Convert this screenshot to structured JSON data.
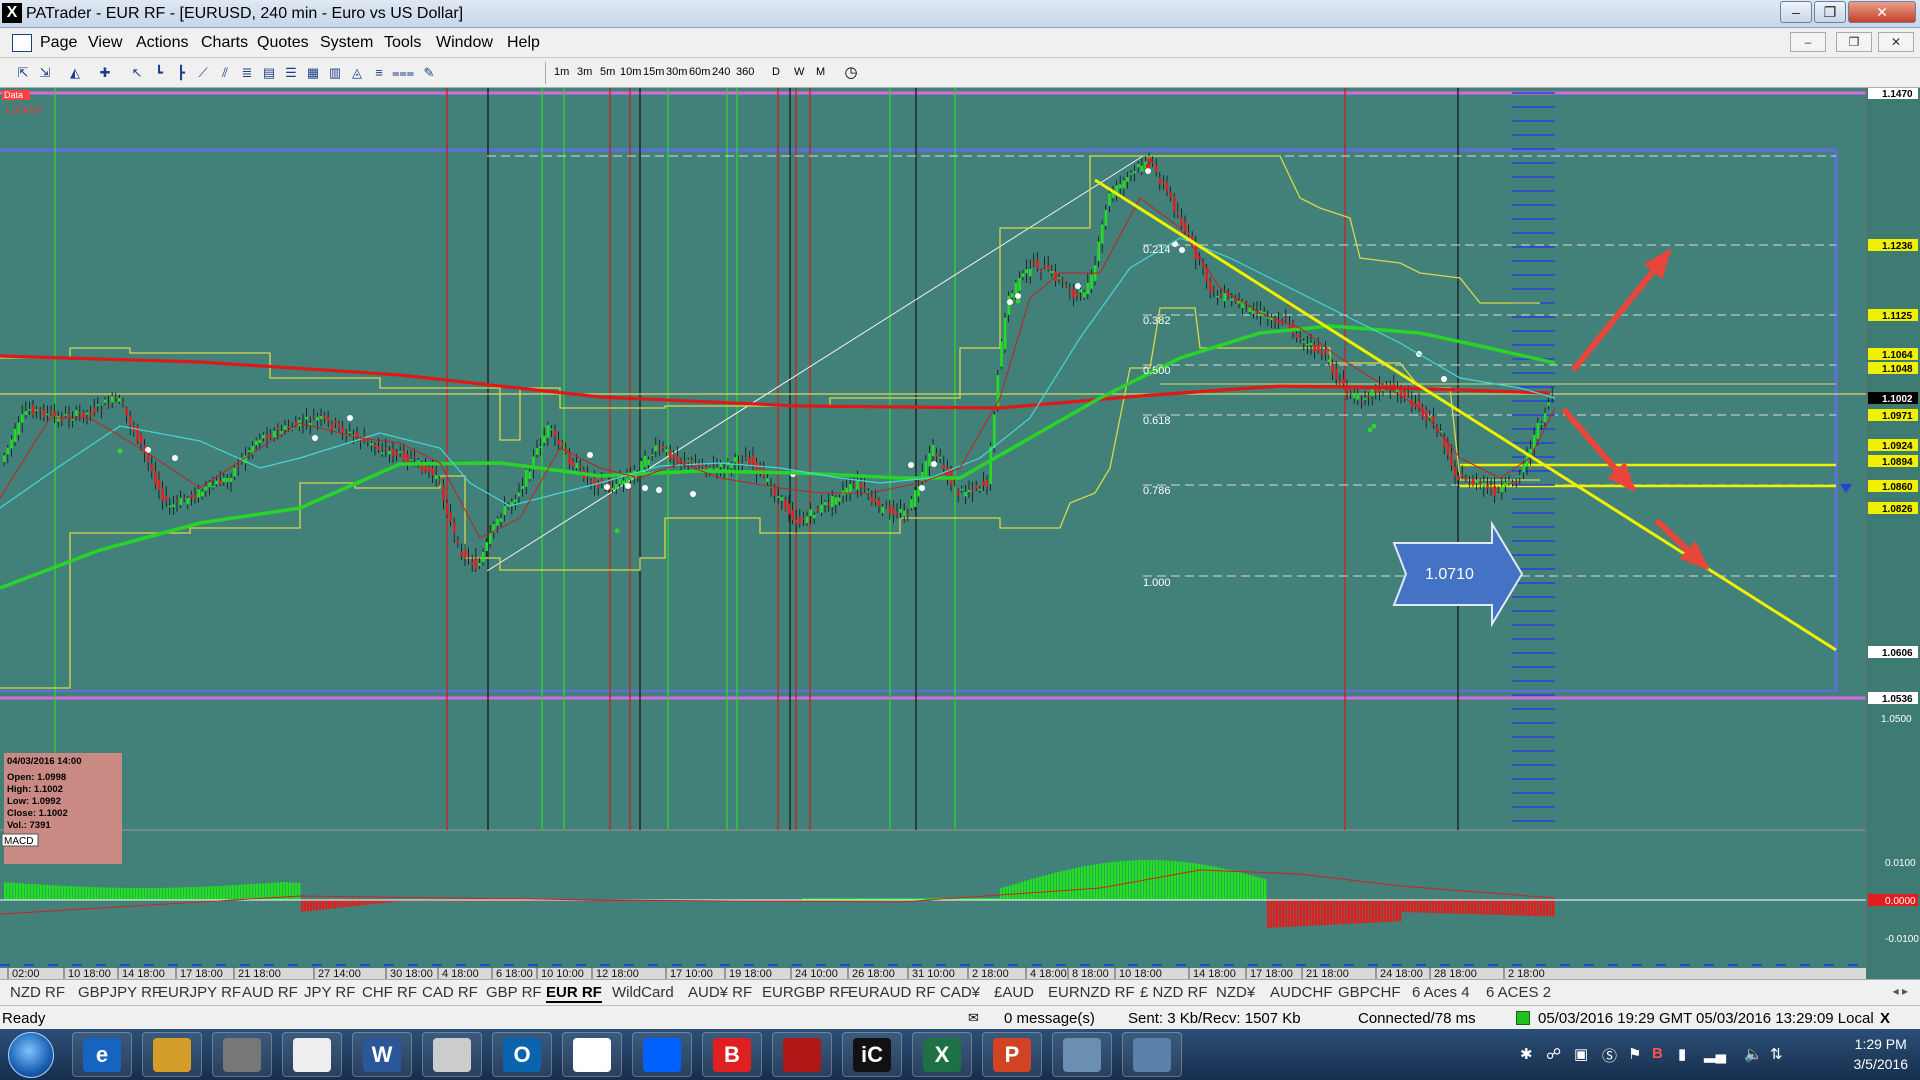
{
  "window": {
    "title": "PATrader - EUR RF - [EURUSD, 240 min - Euro vs US Dollar]",
    "minimize": "–",
    "restore": "❐",
    "close": "✕"
  },
  "menu": [
    "Page",
    "View",
    "Actions",
    "Charts",
    "Quotes",
    "System",
    "Tools",
    "Window",
    "Help"
  ],
  "mdi_controls": [
    "–",
    "❐",
    "✕"
  ],
  "toolbar": {
    "icons": [
      "zoom-in-icon",
      "zoom-out-icon",
      "chart-icon",
      "crosshair-icon",
      "cursor-icon",
      "hline-icon",
      "vline-icon",
      "trendline-icon",
      "channel-icon",
      "fibo-icon",
      "rect-icon",
      "fan-icon",
      "grid-icon",
      "bars-icon",
      "triangle-icon",
      "levels-icon",
      "lines-icon",
      "pen-icon"
    ],
    "timeframes": [
      "1m",
      "3m",
      "5m",
      "10m",
      "15m",
      "30m",
      "60m",
      "240",
      "360",
      "D",
      "W",
      "M"
    ],
    "clock_icon": "clock-icon"
  },
  "chart": {
    "corner_labels": {
      "data": "Data",
      "locked": "Locked"
    },
    "fib_labels": [
      "0.214",
      "0.382",
      "0.500",
      "0.618",
      "0.786",
      "1.000"
    ],
    "target_label": "1.0710",
    "price_labels": [
      "1.1470",
      "1.1236",
      "1.1125",
      "1.1064",
      "1.1048",
      "1.1002",
      "1.0971",
      "1.0924",
      "1.0894",
      "1.0860",
      "1.0826",
      "1.0606",
      "1.0536",
      "1.0500"
    ],
    "highlight_price": "1.1002",
    "info_box": [
      "04/03/2016 14:00",
      "Open: 1.0998",
      "High: 1.1002",
      "Low: 1.0992",
      "Close: 1.1002",
      "Vol.: 7391"
    ],
    "macd": {
      "label": "MACD",
      "scale": [
        "0.0100",
        "0.0000",
        "-0.0100"
      ],
      "hist_colors": {
        "positive": "#21e021",
        "negative": "#e01e1e"
      }
    },
    "time_labels": [
      "02:00",
      "10 18:00",
      "14 18:00",
      "17 18:00",
      "21 18:00",
      "27 14:00",
      "30 18:00",
      "4 18:00",
      "6 18:00",
      "10 10:00",
      "12 18:00",
      "17 10:00",
      "19 18:00",
      "24 10:00",
      "26 18:00",
      "31 10:00",
      "2 18:00",
      "4 18:00",
      "8 18:00",
      "10 18:00",
      "14 18:00",
      "17 18:00",
      "21 18:00",
      "24 18:00",
      "28 18:00",
      "2 18:00"
    ],
    "colors": {
      "background": "#428179",
      "candle_up": "#22dd22",
      "candle_down": "#dd2222",
      "ma_red": "#e01818",
      "ma_green": "#28d428",
      "channel": "#d8d84a",
      "trend_yellow": "#f0f000",
      "arrow": "#e8463a",
      "callout": "#4472c4",
      "frame_purple": "#d86ae0",
      "frame_blue": "#5f6fe0"
    }
  },
  "tabs": [
    "NZD RF",
    "GBPJPY RF",
    "EURJPY RF",
    "AUD RF",
    "JPY RF",
    "CHF RF",
    "CAD RF",
    "GBP RF",
    "EUR RF",
    "WildCard",
    "AUD¥ RF",
    "EURGBP RF",
    "EURAUD RF",
    "CAD¥",
    "£AUD",
    "EURNZD RF",
    "£ NZD RF",
    "NZD¥",
    "AUDCHF",
    "GBPCHF",
    "6 Aces 4",
    "6 ACES 2"
  ],
  "active_tab": "EUR RF",
  "status": {
    "ready": "Ready",
    "messages": "0 message(s)",
    "traffic": "Sent: 3 Kb/Recv: 1507 Kb",
    "connection": "Connected/78 ms",
    "gmt": "05/03/2016 19:29 GMT",
    "local": "05/03/2016 13:29:09 Local"
  },
  "taskbar": {
    "apps": [
      "ie-icon",
      "folder-icon",
      "calendar-icon",
      "window-icon",
      "word-icon",
      "chart-app-icon",
      "outlook-icon",
      "chrome-icon",
      "dropbox-icon",
      "b-app-icon",
      "eagle-icon",
      "ic-icon",
      "excel-icon",
      "powerpoint-icon",
      "tools-icon",
      "people-icon"
    ],
    "app_letters": [
      "e",
      "",
      "",
      "",
      "W",
      "",
      "O",
      "",
      "",
      "B",
      "",
      "iC",
      "X",
      "P",
      "",
      ""
    ],
    "time": "1:29 PM",
    "date": "3/5/2016"
  }
}
